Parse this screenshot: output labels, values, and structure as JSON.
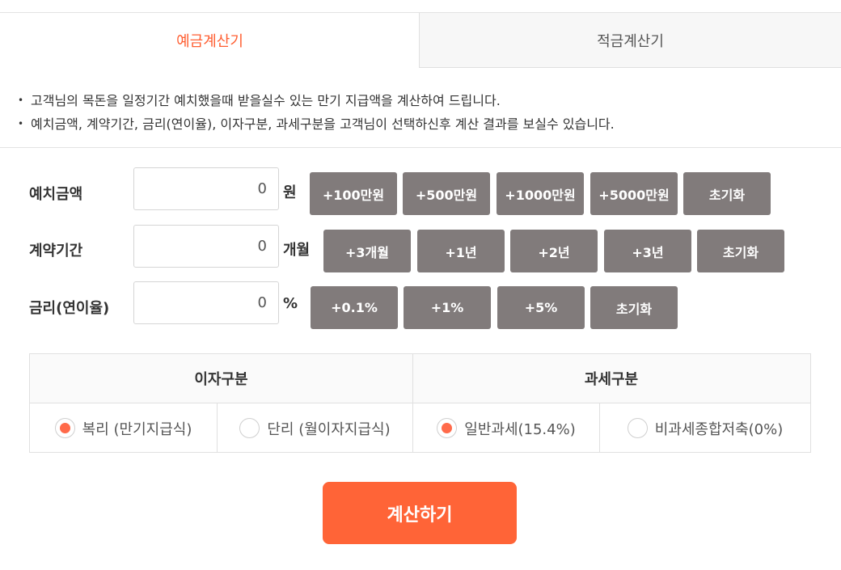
{
  "tabs": {
    "deposit": "예금계산기",
    "savings": "적금계산기"
  },
  "description": [
    "고객님의 목돈을 일정기간 예치했을때 받을실수 있는 만기 지급액을 계산하여 드립니다.",
    "예치금액, 계약기간, 금리(연이율), 이자구분, 과세구분을 고객님이 선택하신후 계산 결과를 보실수 있습니다."
  ],
  "amount": {
    "label": "예치금액",
    "value": "0",
    "unit": "원",
    "buttons": [
      "+100만원",
      "+500만원",
      "+1000만원",
      "+5000만원",
      "초기화"
    ]
  },
  "period": {
    "label": "계약기간",
    "value": "0",
    "unit": "개월",
    "buttons": [
      "+3개월",
      "+1년",
      "+2년",
      "+3년",
      "초기화"
    ]
  },
  "rate": {
    "label": "금리(연이율)",
    "value": "0",
    "unit": "%",
    "buttons": [
      "+0.1%",
      "+1%",
      "+5%",
      "초기화"
    ]
  },
  "options": {
    "interest_header": "이자구분",
    "tax_header": "과세구분",
    "interest_compound": {
      "label": "복리 (만기지급식)",
      "checked": true
    },
    "interest_simple": {
      "label": "단리 (월이자지급식)",
      "checked": false
    },
    "tax_general": {
      "label": "일반과세(15.4%)",
      "checked": true
    },
    "tax_free": {
      "label": "비과세종합저축(0%)",
      "checked": false
    }
  },
  "calculate_label": "계산하기",
  "colors": {
    "accent": "#ff6437",
    "button_gray": "#817b7b",
    "active_tab": "#ff5e31"
  }
}
